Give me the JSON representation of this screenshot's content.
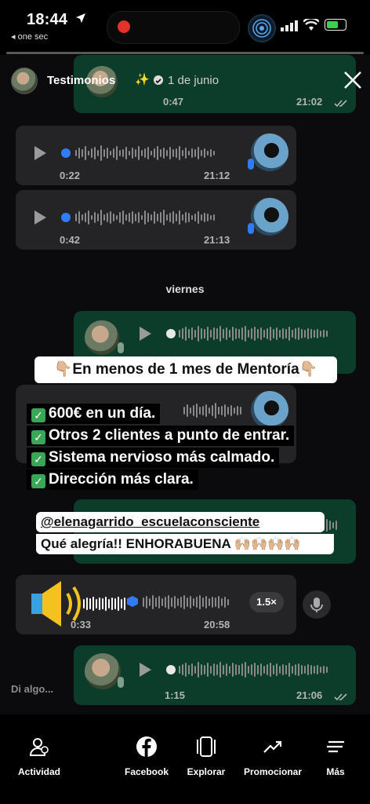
{
  "status": {
    "time": "18:44",
    "back_label": "◂ one sec"
  },
  "header": {
    "account": "Testimonios",
    "sparkle": "✨",
    "date": "1 de junio"
  },
  "messages": [
    {
      "dir": "out",
      "duration": "0:47",
      "time": "21:02"
    },
    {
      "dir": "in",
      "duration": "0:22",
      "time": "21:12"
    },
    {
      "dir": "in",
      "duration": "0:42",
      "time": "21:13"
    },
    {
      "dir": "in",
      "duration": "0:33",
      "time": "20:58",
      "speed": "1.5×"
    },
    {
      "dir": "out",
      "duration": "1:15",
      "time": "21:06"
    }
  ],
  "day_separator": "viernes",
  "stickers": {
    "title": "En menos de 1 mes de Mentoría",
    "checklist": [
      "600€ en un día.",
      "Otros 2 clientes a punto de entrar.",
      "Sistema nervioso más calmado.",
      "Dirección más clara."
    ],
    "mention": "@elenagarrido_escuelaconsciente",
    "congrats": "Qué alegría!! ENHORABUENA"
  },
  "reply_placeholder": "Di algo...",
  "nav": {
    "activity": "Actividad",
    "facebook": "Facebook",
    "explore": "Explorar",
    "promote": "Promocionar",
    "more": "Más"
  },
  "colors": {
    "outgoing_bubble": "#0b3d2a",
    "incoming_bubble": "#242427",
    "accent_blue": "#2f7cf6",
    "check_green": "#3aa757"
  }
}
